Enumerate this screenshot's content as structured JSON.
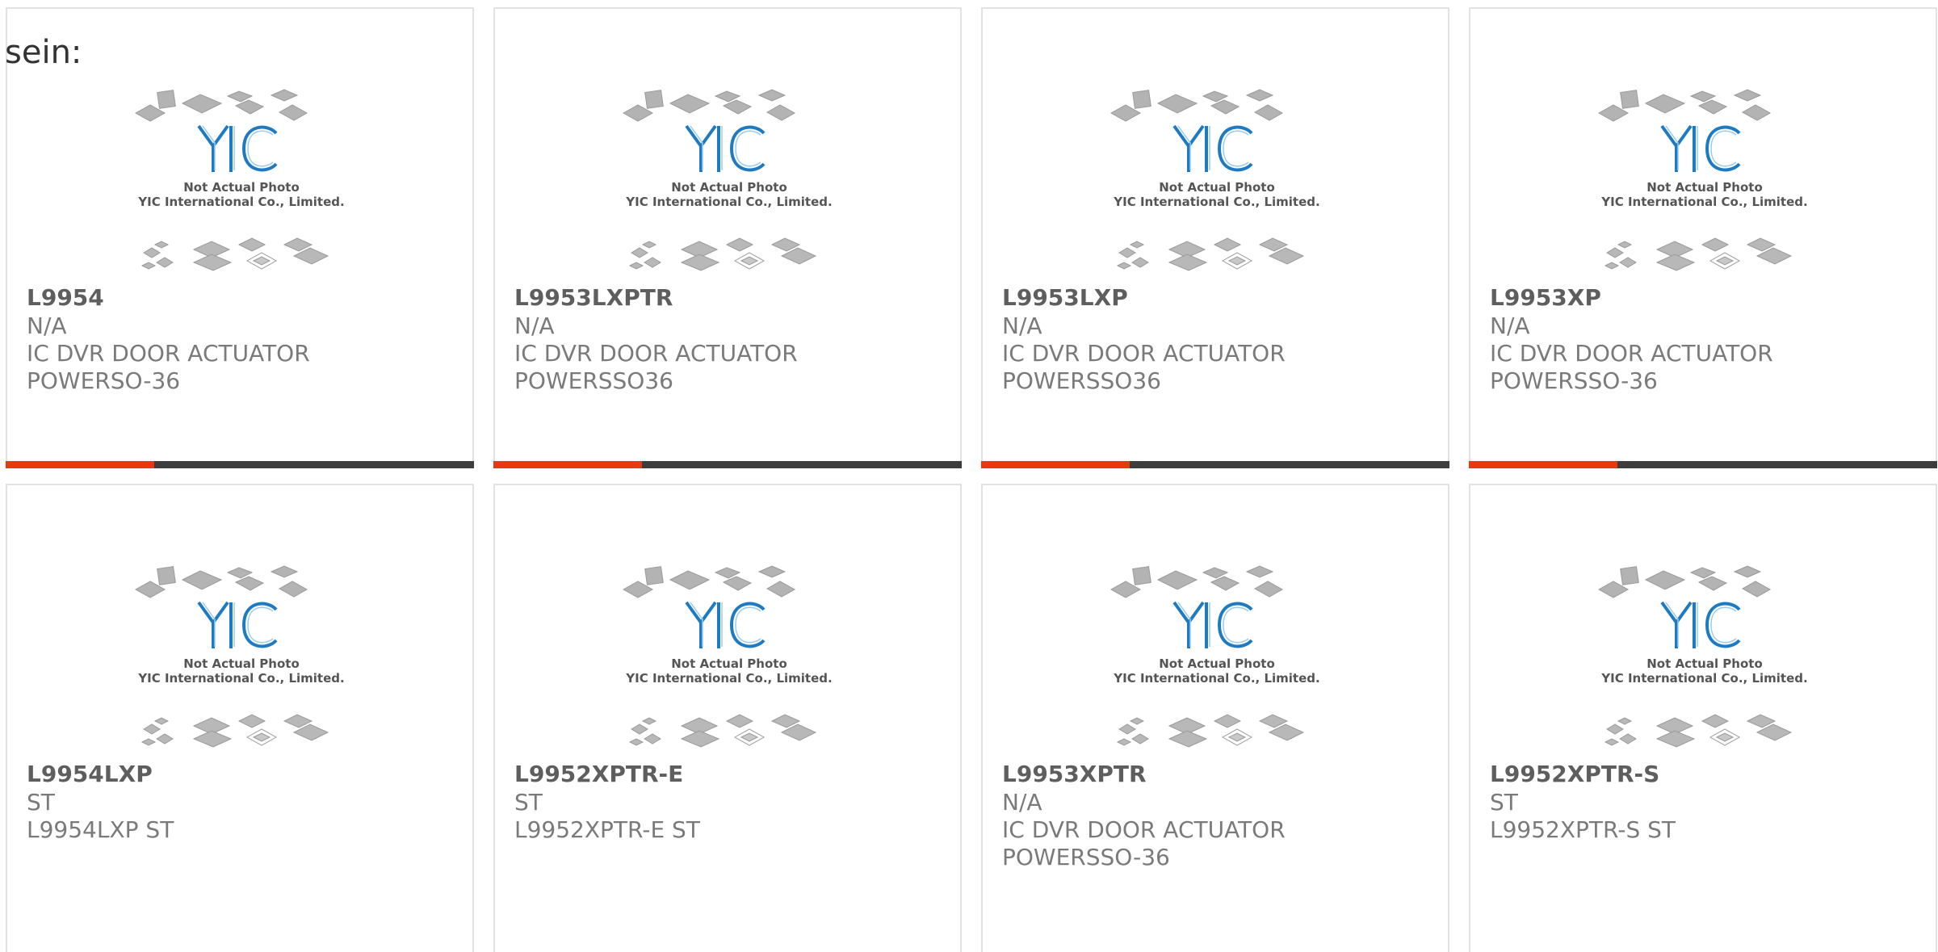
{
  "intro_text": "sein:",
  "placeholder_image": {
    "caption_line1": "Not Actual Photo",
    "caption_line2": "YIC International Co., Limited.",
    "logo_text": "YIC",
    "logo_color": "#1f7bc1"
  },
  "accent_color": "#e8380d",
  "bar_color": "#3d3d3d",
  "products": [
    {
      "part": "L9954",
      "maker": "N/A",
      "desc1": "IC DVR DOOR ACTUATOR",
      "desc2": "POWERSO-36"
    },
    {
      "part": "L9953LXPTR",
      "maker": "N/A",
      "desc1": "IC DVR DOOR ACTUATOR",
      "desc2": "POWERSSO36"
    },
    {
      "part": "L9953LXP",
      "maker": "N/A",
      "desc1": "IC DVR DOOR ACTUATOR",
      "desc2": "POWERSSO36"
    },
    {
      "part": "L9953XP",
      "maker": "N/A",
      "desc1": "IC DVR DOOR ACTUATOR",
      "desc2": "POWERSSO-36"
    },
    {
      "part": "L9954LXP",
      "maker": "ST",
      "desc1": "L9954LXP ST",
      "desc2": ""
    },
    {
      "part": "L9952XPTR-E",
      "maker": "ST",
      "desc1": "L9952XPTR-E ST",
      "desc2": ""
    },
    {
      "part": "L9953XPTR",
      "maker": "N/A",
      "desc1": "IC DVR DOOR ACTUATOR",
      "desc2": "POWERSSO-36"
    },
    {
      "part": "L9952XPTR-S",
      "maker": "ST",
      "desc1": "L9952XPTR-S ST",
      "desc2": ""
    }
  ]
}
